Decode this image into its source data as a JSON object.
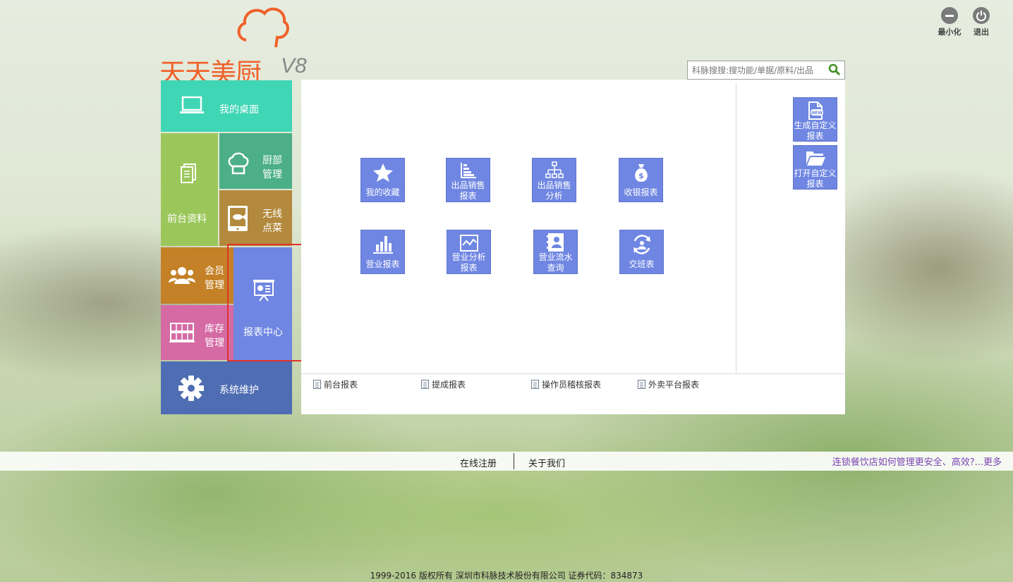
{
  "window": {
    "minimize_label": "最小化",
    "exit_label": "退出"
  },
  "logo": {
    "brand": "天天美厨",
    "version": "V8"
  },
  "search": {
    "placeholder": "科脉搜搜:搜功能/单据/原料/出品"
  },
  "sidebar": {
    "desktop": "我的桌面",
    "front_data": "前台资料",
    "kitchen": [
      "厨部",
      "管理"
    ],
    "wireless": [
      "无线",
      "点菜"
    ],
    "member": [
      "会员",
      "管理"
    ],
    "stock": [
      "库存",
      "管理"
    ],
    "report_center": "报表中心",
    "system": "系统维护"
  },
  "functions": {
    "favorites": "我的收藏",
    "sales_report": [
      "出品销售",
      "报表"
    ],
    "sales_analysis": [
      "出品销售",
      "分析"
    ],
    "cashier_report": "收银报表",
    "business_report": "营业报表",
    "business_analysis": [
      "营业分析",
      "报表"
    ],
    "business_flow": [
      "营业流水",
      "查询"
    ],
    "shift_report": "交班表"
  },
  "custom": {
    "create": [
      "生成自定义",
      "报表"
    ],
    "open": [
      "打开自定义",
      "报表"
    ],
    "new_badge": "NEW"
  },
  "sub_links": [
    "前台报表",
    "提成报表",
    "操作员稽核报表",
    "外卖平台报表"
  ],
  "footer": {
    "register": "在线注册",
    "about": "关于我们",
    "news": "连锁餐饮店如何管理更安全、高效?...更多",
    "copyright": "1999-2016  版权所有  深圳市科脉技术股份有限公司  证券代码：834873"
  },
  "colors": {
    "accent": "#6f86e2",
    "logo": "#f0612a",
    "highlight_border": "#e0332b"
  }
}
